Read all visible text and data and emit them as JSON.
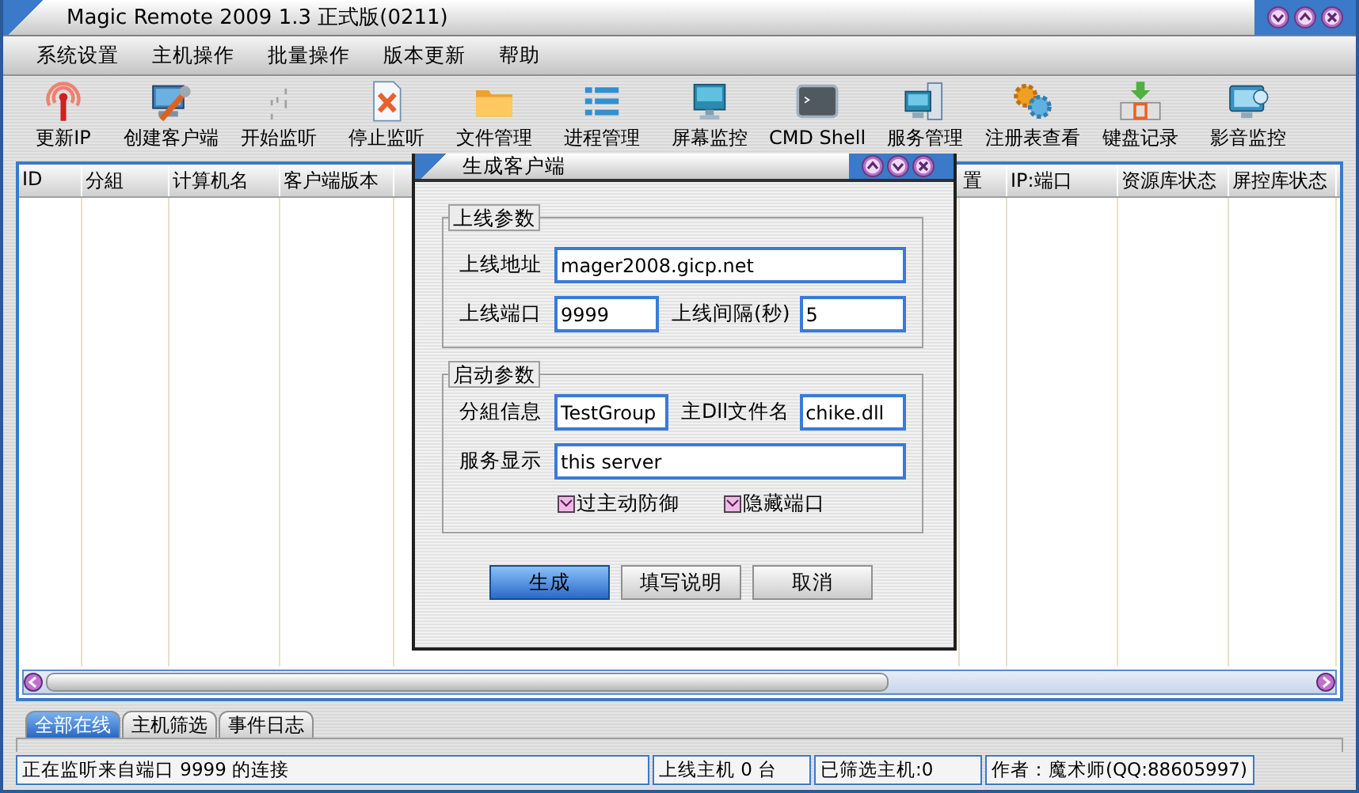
{
  "window": {
    "title": "Magic Remote 2009 1.3 正式版(0211)"
  },
  "menu": [
    "系统设置",
    "主机操作",
    "批量操作",
    "版本更新",
    "帮助"
  ],
  "toolbar": [
    "更新IP",
    "创建客户端",
    "开始监听",
    "停止监听",
    "文件管理",
    "进程管理",
    "屏幕监控",
    "CMD Shell",
    "服务管理",
    "注册表查看",
    "键盘记录",
    "影音监控"
  ],
  "table": {
    "columns": [
      "ID",
      "分組",
      "计算机名",
      "客户端版本",
      "置",
      "IP:端口",
      "资源库状态",
      "屏控库状态"
    ]
  },
  "tabs": [
    {
      "label": "全部在线",
      "selected": true
    },
    {
      "label": "主机筛选",
      "selected": false
    },
    {
      "label": "事件日志",
      "selected": false
    }
  ],
  "status_bar": [
    "正在监听来自端口 9999 的连接",
    "上线主机 0 台",
    "已筛选主机:0",
    "作者：魔术师(QQ:88605997)"
  ],
  "dialog": {
    "title": "生成客户端",
    "groups": [
      {
        "title": "上线参数",
        "rows": [
          [
            {
              "label": "上线地址",
              "value": "mager2008.gicp.net"
            }
          ],
          [
            {
              "label": "上线端口",
              "value": "9999"
            },
            {
              "label": "上线间隔(秒)",
              "value": "5"
            }
          ]
        ]
      },
      {
        "title": "启动参数",
        "rows": [
          [
            {
              "label": "分組信息",
              "value": "TestGroup"
            },
            {
              "label": "主Dll文件名",
              "value": "chike.dll"
            }
          ],
          [
            {
              "label": "服务显示",
              "value": "this server"
            }
          ]
        ],
        "checkboxes": [
          {
            "label": "过主动防御",
            "checked": true
          },
          {
            "label": "隐藏端口",
            "checked": true
          }
        ]
      }
    ],
    "buttons": [
      {
        "label": "生成",
        "default": true
      },
      {
        "label": "填写说明",
        "default": false
      },
      {
        "label": "取消",
        "default": false
      }
    ]
  }
}
